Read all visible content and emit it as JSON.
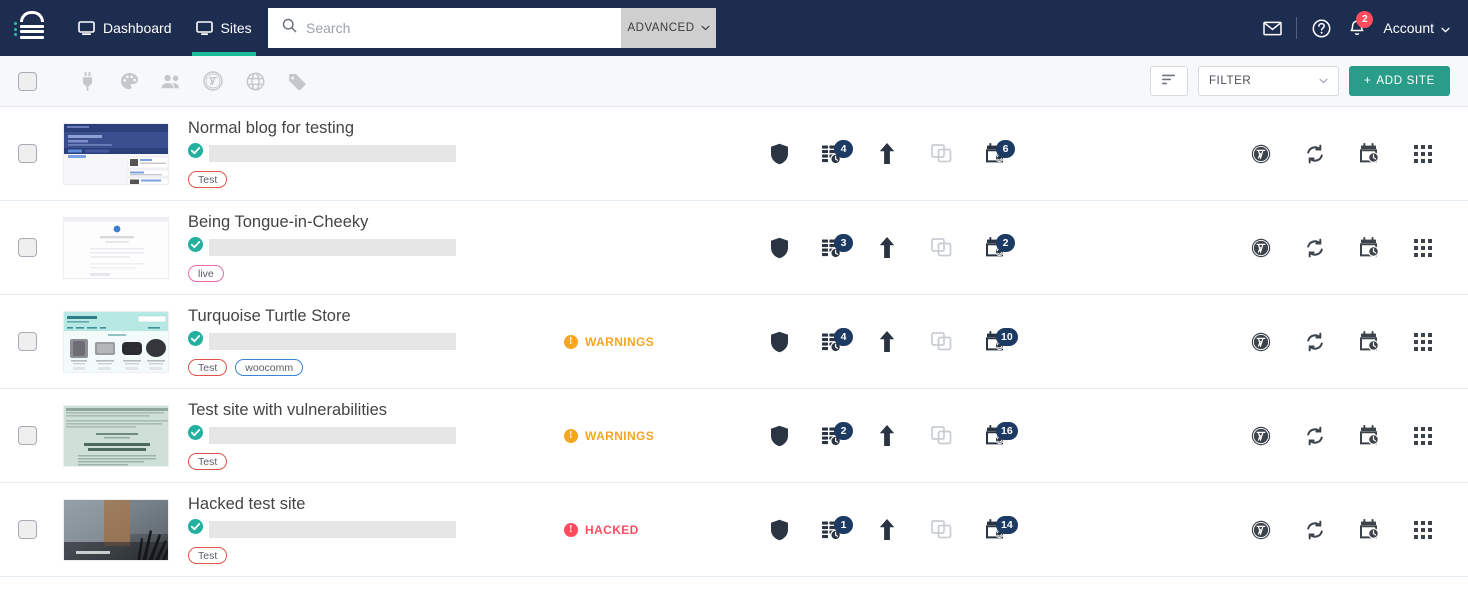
{
  "header": {
    "logo_name": "managewp-logo",
    "nav": [
      {
        "label": "Dashboard",
        "icon": "monitor-icon",
        "active": false
      },
      {
        "label": "Sites",
        "icon": "screen-icon",
        "active": true
      }
    ],
    "search": {
      "placeholder": "Search",
      "value": ""
    },
    "advanced_label": "ADVANCED",
    "icons": [
      {
        "name": "mail-icon"
      },
      {
        "name": "help-icon"
      },
      {
        "name": "bell-icon",
        "badge": "2"
      }
    ],
    "account_label": "Account",
    "notification_count": "2"
  },
  "toolbar": {
    "select_all": "select-all-checkbox",
    "icons": [
      {
        "name": "plug-icon",
        "title": "Plugins"
      },
      {
        "name": "palette-icon",
        "title": "Themes"
      },
      {
        "name": "users-icon",
        "title": "Users"
      },
      {
        "name": "wordpress-icon",
        "title": "WordPress"
      },
      {
        "name": "globe-icon",
        "title": "Domains"
      },
      {
        "name": "tag-icon",
        "title": "Tags"
      }
    ],
    "sort_label": "sort-icon",
    "filter_label": "FILTER",
    "add_site_label": "ADD SITE",
    "add_site_plus": "+",
    "accent_color": "#2a9d8a"
  },
  "colors": {
    "header_bg": "#1d2d4f",
    "accent_teal": "#1abc9c",
    "badge_navy": "#1d3a63",
    "warning": "#f5a623",
    "hacked": "#ff4d5e",
    "tag_test": "#e0544a",
    "tag_live": "#e86bb0",
    "tag_woocomm": "#3b86d0"
  },
  "sites": [
    {
      "title": "Normal blog for testing",
      "url_masked": true,
      "connected": true,
      "tags": [
        {
          "label": "Test",
          "color": "#e0544a"
        }
      ],
      "status": null,
      "status_label": "",
      "backups_badge": "4",
      "updates_badge": "6",
      "clone_enabled": false,
      "thumb": "blog-dark-blue"
    },
    {
      "title": "Being Tongue-in-Cheeky",
      "url_masked": true,
      "connected": true,
      "tags": [
        {
          "label": "live",
          "color": "#e86bb0"
        }
      ],
      "status": null,
      "status_label": "",
      "backups_badge": "3",
      "updates_badge": "2",
      "clone_enabled": false,
      "thumb": "white-doc"
    },
    {
      "title": "Turquoise Turtle Store",
      "url_masked": true,
      "connected": true,
      "tags": [
        {
          "label": "Test",
          "color": "#e0544a"
        },
        {
          "label": "woocomm",
          "color": "#3b86d0"
        }
      ],
      "status": "warn",
      "status_label": "WARNINGS",
      "backups_badge": "4",
      "updates_badge": "10",
      "clone_enabled": false,
      "thumb": "turquoise-store"
    },
    {
      "title": "Test site with vulnerabilities",
      "url_masked": true,
      "connected": true,
      "tags": [
        {
          "label": "Test",
          "color": "#e0544a"
        }
      ],
      "status": "warn",
      "status_label": "WARNINGS",
      "backups_badge": "2",
      "updates_badge": "16",
      "clone_enabled": false,
      "thumb": "mint-page"
    },
    {
      "title": "Hacked test site",
      "url_masked": true,
      "connected": true,
      "tags": [
        {
          "label": "Test",
          "color": "#e0544a"
        }
      ],
      "status": "hack",
      "status_label": "HACKED",
      "backups_badge": "1",
      "updates_badge": "14",
      "clone_enabled": false,
      "thumb": "dark-photo"
    }
  ],
  "row_actions": {
    "security": "shield-icon",
    "backups": "backup-database-icon",
    "performance": "arrow-up-icon",
    "clone": "clone-icon",
    "updates": "calendar-sync-icon"
  },
  "row_actions_right": {
    "wordpress": "wordpress-icon",
    "sync": "sync-icon",
    "schedule": "calendar-clock-icon",
    "menu": "grid-menu-icon"
  }
}
